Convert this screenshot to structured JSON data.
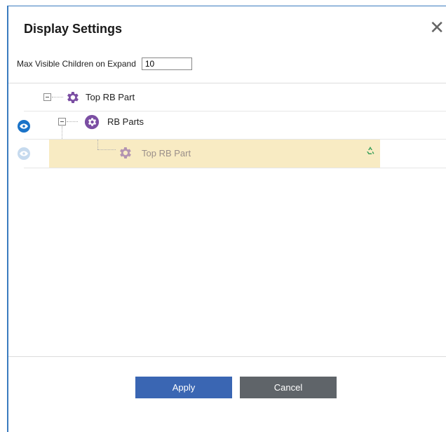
{
  "dialog": {
    "title": "Display Settings",
    "close_glyph": "✕"
  },
  "max_children": {
    "label": "Max Visible Children on Expand",
    "value": "10"
  },
  "tree": [
    {
      "label": "Top RB Part",
      "icon": "gear-icon",
      "level": 0,
      "eye": "none",
      "state": "expanded"
    },
    {
      "label": "RB Parts",
      "icon": "gear-circle-icon",
      "level": 1,
      "eye": "visible",
      "state": "expanded"
    },
    {
      "label": "Top RB Part",
      "icon": "gear-icon",
      "level": 2,
      "eye": "faded",
      "state": "leaf",
      "highlighted": true,
      "badge": "recycle-icon"
    }
  ],
  "buttons": {
    "apply_label": "Apply",
    "cancel_label": "Cancel"
  },
  "colors": {
    "accent": "#3a66b3",
    "icon_purple": "#7b4ea3",
    "highlight": "#f8ebc3",
    "cancel": "#5f6469"
  }
}
